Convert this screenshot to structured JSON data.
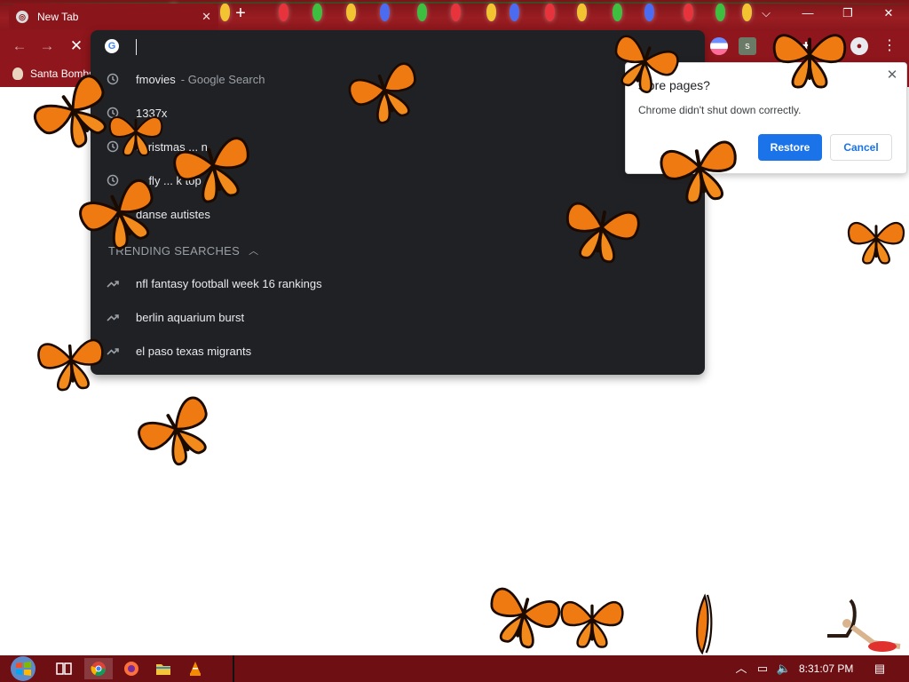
{
  "window": {
    "tab_title": "New Tab",
    "tab_close": "✕",
    "new_tab": "+",
    "controls": {
      "dropdown": "⌵",
      "minimize": "—",
      "restore": "❐",
      "close": "✕"
    }
  },
  "toolbar": {
    "back": "←",
    "forward": "→",
    "stop": "✕",
    "profile_icon": "person-icon",
    "menu": "⋮"
  },
  "bookmarks": {
    "item1": "Santa Bombs"
  },
  "omnibox": {
    "value": "",
    "suggestions": [
      {
        "text": "fmovies",
        "sub": "- Google Search",
        "icon": "history-icon"
      },
      {
        "text": "1337x",
        "sub": "",
        "icon": "history-icon"
      },
      {
        "text": "christmas ... n",
        "sub": "",
        "icon": "history-icon"
      },
      {
        "text": "... fly ... k top",
        "sub": "",
        "icon": "history-icon"
      },
      {
        "text": "danse autistes",
        "sub": "",
        "icon": "history-icon"
      }
    ],
    "trending_header": "TRENDING SEARCHES",
    "trending": [
      {
        "text": "nfl fantasy football week 16 rankings",
        "icon": "trending-icon"
      },
      {
        "text": "berlin aquarium burst",
        "icon": "trending-icon"
      },
      {
        "text": "el paso texas migrants",
        "icon": "trending-icon"
      }
    ]
  },
  "dialog": {
    "title": "store pages?",
    "message": "Chrome didn't shut down correctly.",
    "restore_label": "Restore",
    "cancel_label": "Cancel",
    "close": "✕"
  },
  "taskbar": {
    "time": "8:31:07 PM",
    "apps": [
      "start-button",
      "task-view",
      "chrome",
      "firefox",
      "file-explorer",
      "vlc"
    ]
  },
  "colors": {
    "tab_strip": "#8e161c",
    "omnibox_bg": "#202124",
    "accent": "#1a73e8",
    "butterfly": "#f07a12"
  }
}
